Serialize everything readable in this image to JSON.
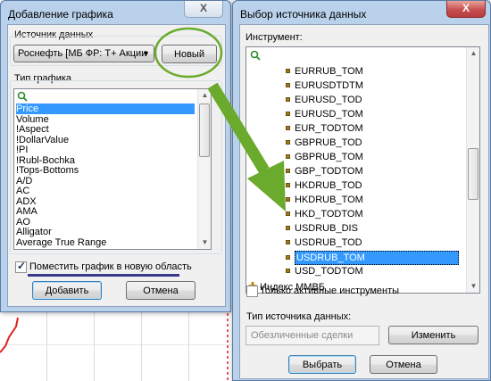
{
  "dialog_add_chart": {
    "title": "Добавление графика",
    "close_label": "X",
    "source_label": "Источник данных",
    "source_value": "Роснефть [МБ ФР: Т+ Акции",
    "new_button": "Новый",
    "chart_type_label": "Тип графика",
    "chart_types": [
      "Price",
      "Volume",
      "!Aspect",
      "!DollarValue",
      "!PI",
      "!Rubl-Bochka",
      "!Tops-Bottoms",
      "A/D",
      "AC",
      "ADX",
      "AMA",
      "AO",
      "Alligator",
      "Average True Range"
    ],
    "selected_index": 0,
    "new_area_checkbox": "Поместить график в новую область",
    "new_area_checked": true,
    "add_button": "Добавить",
    "cancel_button": "Отмена"
  },
  "dialog_source": {
    "title": "Выбор источника данных",
    "close_label": "X",
    "instrument_label": "Инструмент:",
    "instruments": [
      "EURRUB_TOM",
      "EURUSDTDTM",
      "EURUSD_TOD",
      "EURUSD_TOM",
      "EUR_TODTOM",
      "GBPRUB_TOD",
      "GBPRUB_TOM",
      "GBP_TODTOM",
      "HKDRUB_TOD",
      "HKDRUB_TOM",
      "HKD_TODTOM",
      "USDRUB_DIS",
      "USDRUB_TOD",
      "USDRUB_TOM",
      "USD_TODTOM"
    ],
    "selected_index": 13,
    "group_item": "Индекс ММВБ",
    "active_only_checkbox": "Только активные инструменты",
    "active_only_checked": false,
    "source_type_label": "Тип источника данных:",
    "source_type_value": "Обезличенные сделки",
    "change_button": "Изменить",
    "select_button": "Выбрать",
    "cancel_button": "Отмена"
  },
  "colors": {
    "annotation_green": "#6aaa2c",
    "selection_blue": "#3399ff",
    "chart_line_red": "#e02020"
  }
}
